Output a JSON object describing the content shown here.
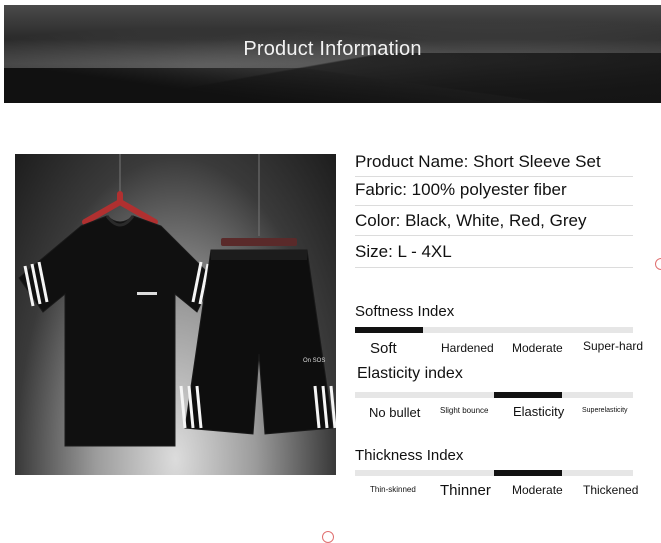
{
  "banner": {
    "title": "Product Information",
    "fine_line_1": "",
    "fine_line_2": ""
  },
  "photo": {
    "alt_icon": "tshirt-shorts-photo",
    "shorts_tag": "On SOS"
  },
  "product": {
    "name_line": "Product Name: Short Sleeve Set",
    "fabric_line": "Fabric: 100% polyester fiber",
    "color_line": "Color: Black, White, Red, Grey",
    "size_line": "Size: L - 4XL"
  },
  "indices": {
    "softness": {
      "title": "Softness Index",
      "labels": [
        "Soft",
        "Hardened",
        "Moderate",
        "Super-hard"
      ],
      "level_index": 0
    },
    "elasticity": {
      "title": "Elasticity index",
      "labels": [
        "No bullet",
        "Slight bounce",
        "Elasticity",
        "Superelasticity"
      ],
      "level_index": 2
    },
    "thickness": {
      "title": "Thickness Index",
      "labels": [
        "Thin-skinned",
        "Thinner",
        "Moderate",
        "Thickened"
      ],
      "level_index": 2
    }
  },
  "colors": {
    "indicator": "#111111",
    "track": "#e6e6e6"
  }
}
